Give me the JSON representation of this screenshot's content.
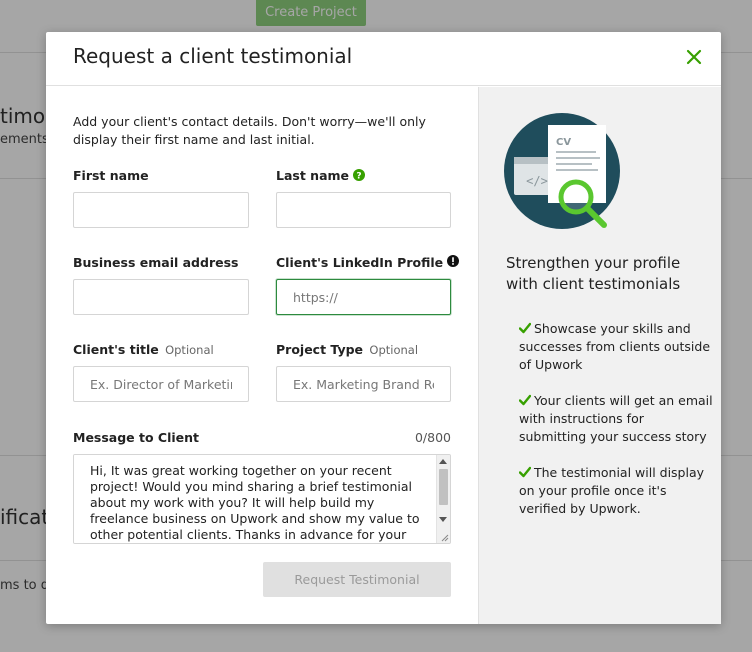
{
  "background": {
    "create_project_label": "Create Project",
    "frag_heading_1": "timoni",
    "frag_text_1": "ements",
    "frag_heading_2": "ificat",
    "frag_text_2": "ms to di"
  },
  "modal": {
    "title": "Request a client testimonial",
    "intro": "Add your client's contact details. Don't worry—we'll only display their first name and last initial.",
    "fields": {
      "first_name": {
        "label": "First name",
        "value": "",
        "placeholder": ""
      },
      "last_name": {
        "label": "Last name",
        "value": "",
        "placeholder": ""
      },
      "email": {
        "label": "Business email address",
        "value": "",
        "placeholder": ""
      },
      "linkedin": {
        "label": "Client's LinkedIn Profile",
        "value": "",
        "placeholder": "https://"
      },
      "client_title": {
        "label": "Client's title",
        "optional": "Optional",
        "value": "",
        "placeholder": "Ex. Director of Marketing"
      },
      "project_type": {
        "label": "Project Type",
        "optional": "Optional",
        "value": "",
        "placeholder": "Ex. Marketing Brand Redesign"
      }
    },
    "message": {
      "label": "Message to Client",
      "counter": "0/800",
      "value": "Hi, It was great working together on your recent project! Would you mind sharing a brief testimonial about my work with you? It will help build my freelance business on Upwork and show my value to other potential clients. Thanks in advance for your help!"
    },
    "submit_label": "Request Testimonial",
    "sidebar": {
      "title": "Strengthen your profile with client testimonials",
      "benefits": [
        "Showcase your skills and successes from clients outside of Upwork",
        "Your clients will get an email with instructions for submitting your success story",
        "The testimonial will display on your profile once it's verified by Upwork."
      ],
      "cv_text": "CV"
    }
  },
  "colors": {
    "brand_green": "#37a000",
    "focus_green": "#2d8a3e",
    "illustration_bg": "#1f4d5c"
  }
}
